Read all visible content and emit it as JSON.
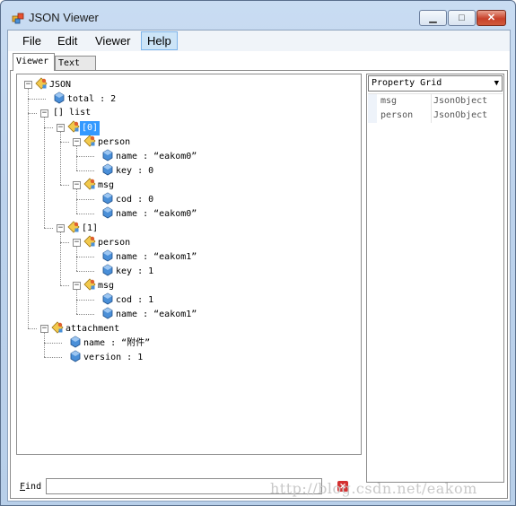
{
  "window": {
    "title": "JSON Viewer"
  },
  "menu": {
    "items": [
      "File",
      "Edit",
      "Viewer",
      "Help"
    ],
    "active": "Help"
  },
  "tabs": [
    "Viewer",
    "Text"
  ],
  "tree": [
    {
      "label": "JSON"
    },
    {
      "label": "total : 2"
    },
    {
      "label": "[] list"
    },
    {
      "label": "[0]"
    },
    {
      "label": "person"
    },
    {
      "label": "name : “eakom0”"
    },
    {
      "label": "key : 0"
    },
    {
      "label": "msg"
    },
    {
      "label": "cod : 0"
    },
    {
      "label": "name : “eakom0”"
    },
    {
      "label": "[1]"
    },
    {
      "label": "person"
    },
    {
      "label": "name : “eakom1”"
    },
    {
      "label": "key : 1"
    },
    {
      "label": "msg"
    },
    {
      "label": "cod : 1"
    },
    {
      "label": "name : “eakom1”"
    },
    {
      "label": "attachment"
    },
    {
      "label": "name : “附件”"
    },
    {
      "label": "version : 1"
    }
  ],
  "find": {
    "label": "Find",
    "value": ""
  },
  "property_grid": {
    "selector": "Property Grid",
    "rows": [
      {
        "key": "msg",
        "value": "JsonObject"
      },
      {
        "key": "person",
        "value": "JsonObject"
      }
    ]
  },
  "watermark": "http://blog.csdn.net/eakom"
}
